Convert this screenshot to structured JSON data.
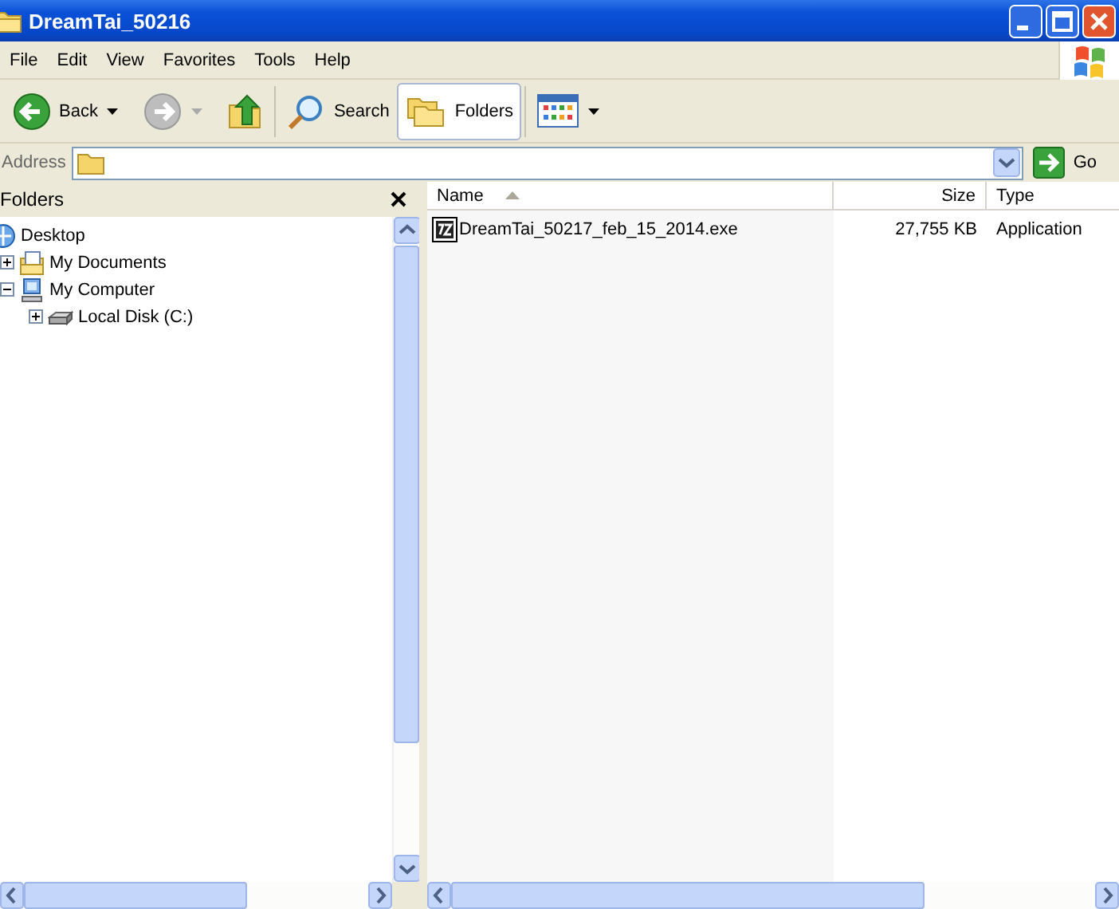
{
  "window": {
    "title": "DreamTai_50216"
  },
  "menu": [
    "File",
    "Edit",
    "View",
    "Favorites",
    "Tools",
    "Help"
  ],
  "toolbar": [
    {
      "kind": "back",
      "label": "Back",
      "disabled": false
    },
    {
      "kind": "forward",
      "disabled": true
    },
    {
      "kind": "up"
    },
    {
      "kind": "search",
      "label": "Search",
      "selected": false
    },
    {
      "kind": "folders",
      "label": "Folders",
      "selected": true
    },
    {
      "kind": "views"
    }
  ],
  "address": {
    "label": "Address",
    "go": "Go"
  },
  "folders_pane": {
    "title": "Folders",
    "tree": [
      {
        "label": "Desktop",
        "kind": "desktop",
        "children": [
          {
            "label": "My Documents",
            "kind": "documents",
            "expanded": false
          },
          {
            "label": "My Computer",
            "kind": "computer",
            "expanded": true,
            "children": [
              {
                "label": "Local Disk (C:)",
                "kind": "disk",
                "expanded": false
              }
            ]
          }
        ]
      }
    ]
  },
  "files": {
    "columns": [
      {
        "label": "Name",
        "sorted": true
      },
      {
        "label": "Size",
        "sorted": false
      },
      {
        "label": "Type",
        "sorted": false
      }
    ],
    "rows": [
      {
        "name": "DreamTai_50217_feb_15_2014.exe",
        "size": "27,755 KB",
        "type": "Application"
      }
    ]
  }
}
